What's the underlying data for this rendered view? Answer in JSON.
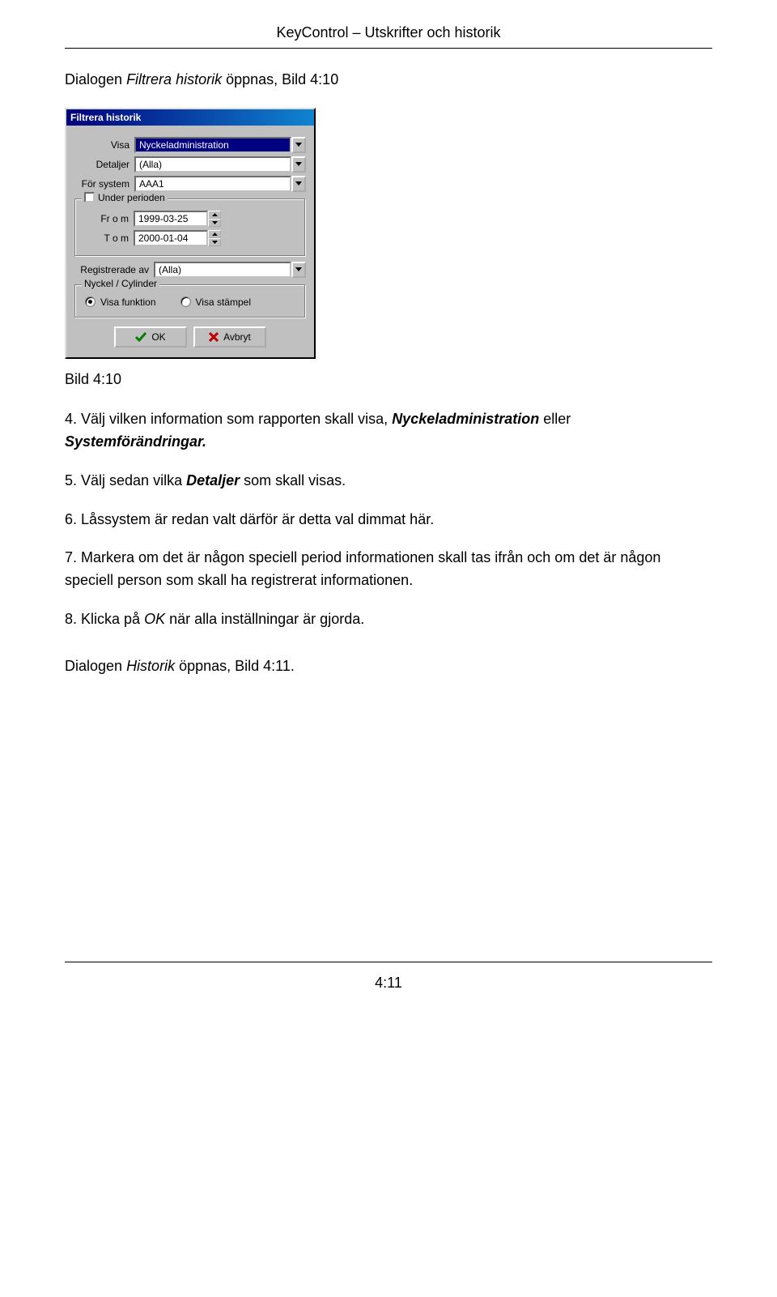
{
  "header": {
    "title": "KeyControl – Utskrifter och historik"
  },
  "intro": {
    "prefix": "Dialogen ",
    "dialog_name": "Filtrera historik",
    "suffix": " öppnas, Bild 4:10"
  },
  "dialog": {
    "title": "Filtrera historik",
    "visa": {
      "label": "Visa",
      "value": "Nyckeladministration"
    },
    "detaljer": {
      "label": "Detaljer",
      "value": "(Alla)"
    },
    "for_system": {
      "label": "För system",
      "value": "AAA1"
    },
    "period": {
      "legend": "Under perioden",
      "from_label": "Fr o m",
      "from_value": "1999-03-25",
      "to_label": "T o m",
      "to_value": "2000-01-04"
    },
    "registrerade": {
      "label": "Registrerade av",
      "value": "(Alla)"
    },
    "nyckel_group": {
      "legend": "Nyckel / Cylinder",
      "opt1": "Visa funktion",
      "opt2": "Visa stämpel"
    },
    "buttons": {
      "ok": "OK",
      "cancel": "Avbryt"
    }
  },
  "caption": "Bild 4:10",
  "steps": {
    "s4": {
      "pre": "4. Välj vilken information som rapporten skall visa, ",
      "em1": "Nyckeladministration",
      "mid": " eller ",
      "em2": "Systemförändringar."
    },
    "s5": {
      "pre": "5. Välj sedan vilka ",
      "em": "Detaljer",
      "post": " som skall visas."
    },
    "s6": "6. Låssystem är redan valt därför är detta val dimmat här.",
    "s7": "7. Markera om det är någon speciell period informationen skall tas ifrån och om det är någon speciell person som skall ha registrerat informationen.",
    "s8": {
      "pre": "8. Klicka på ",
      "em": "OK",
      "post": " när alla inställningar är gjorda."
    }
  },
  "outro": {
    "pre": "Dialogen ",
    "em": "Historik",
    "post": " öppnas, Bild 4:11."
  },
  "page_number": "4:11"
}
